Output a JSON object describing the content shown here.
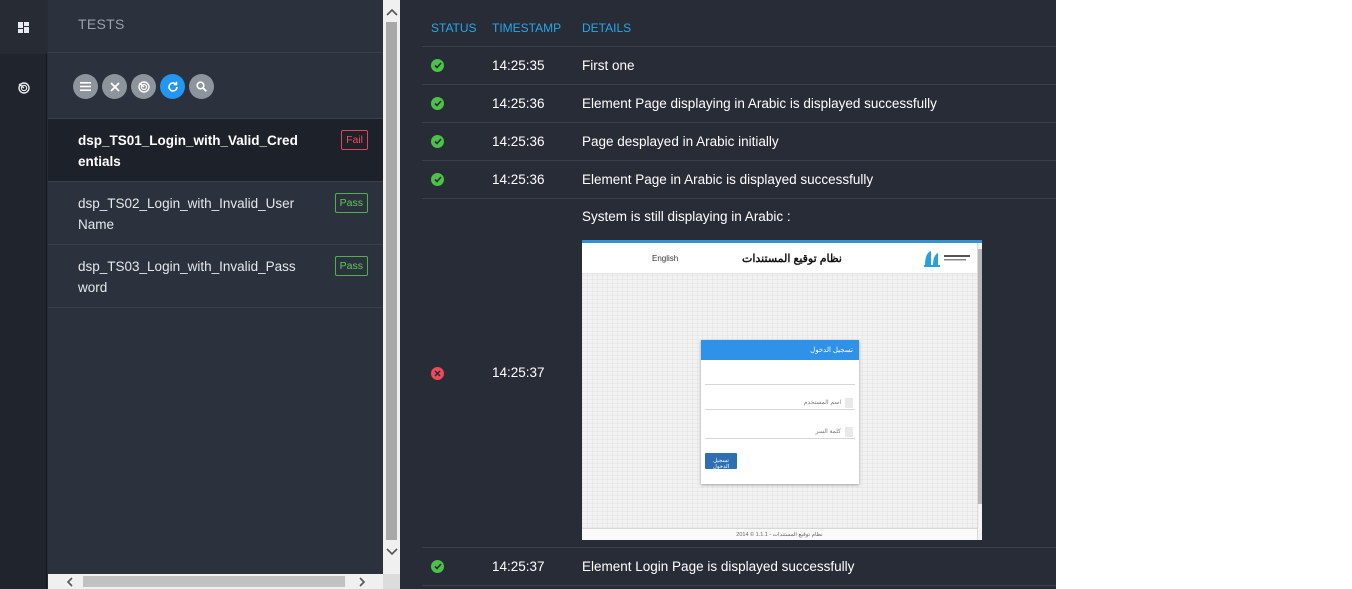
{
  "tests_panel": {
    "title": "TESTS",
    "toolbar": [
      {
        "icon": "list-icon"
      },
      {
        "icon": "close-icon"
      },
      {
        "icon": "dashboard-icon"
      },
      {
        "icon": "refresh-icon"
      },
      {
        "icon": "search-icon"
      }
    ],
    "tests": [
      {
        "name": "dsp_TS01_Login_with_Valid_Credentials",
        "status": "Fail",
        "active": true
      },
      {
        "name": "dsp_TS02_Login_with_Invalid_UserName",
        "status": "Pass",
        "active": false
      },
      {
        "name": "dsp_TS03_Login_with_Invalid_Password",
        "status": "Pass",
        "active": false
      }
    ]
  },
  "rail": {
    "items": [
      {
        "icon": "dashboard-grid-icon"
      },
      {
        "icon": "speed-gauge-icon"
      }
    ]
  },
  "log": {
    "headers": {
      "status": "STATUS",
      "timestamp": "TIMESTAMP",
      "details": "DETAILS"
    },
    "rows": [
      {
        "status": "pass",
        "timestamp": "14:25:35",
        "details": "First one"
      },
      {
        "status": "pass",
        "timestamp": "14:25:36",
        "details": "Element Page displaying in Arabic is displayed successfully"
      },
      {
        "status": "pass",
        "timestamp": "14:25:36",
        "details": "Page desplayed in Arabic initially"
      },
      {
        "status": "pass",
        "timestamp": "14:25:36",
        "details": "Element Page in Arabic is displayed successfully"
      },
      {
        "status": "fail",
        "timestamp": "14:25:37",
        "details": "System is still displaying in Arabic :"
      },
      {
        "status": "pass",
        "timestamp": "14:25:37",
        "details": "Element Login Page is displayed successfully"
      }
    ]
  },
  "screenshot": {
    "title": "نظام توقيع المستندات",
    "logout": "English",
    "card_title": "تسجيل الدخول",
    "username_placeholder": "اسم المستخدم",
    "password_placeholder": "كلمة السر",
    "login_button": "تسجيل الدخول",
    "footer": "2014 © نظام توقيع المستندات - 1.1.1"
  },
  "colors": {
    "accent": "#29a6e6",
    "pass": "#4ec14a",
    "fail": "#f1485a",
    "background": "#272c36"
  }
}
